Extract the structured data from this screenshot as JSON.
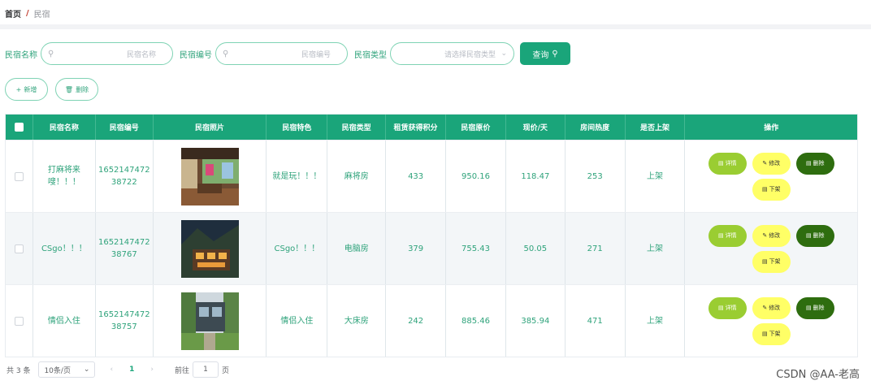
{
  "breadcrumb": {
    "home": "首页",
    "sep": "/",
    "current": "民宿"
  },
  "search": {
    "name_label": "民宿名称",
    "name_placeholder": "民宿名称",
    "code_label": "民宿编号",
    "code_placeholder": "民宿编号",
    "type_label": "民宿类型",
    "type_placeholder": "请选择民宿类型",
    "query_label": "查询"
  },
  "actions": {
    "add_label": "新增",
    "delete_label": "删除"
  },
  "table": {
    "headers": [
      "民宿名称",
      "民宿编号",
      "民宿照片",
      "民宿特色",
      "民宿类型",
      "租赁获得积分",
      "民宿原价",
      "现价/天",
      "房间热度",
      "是否上架",
      "操作"
    ],
    "rows": [
      {
        "name": "打麻将来嗖！！！",
        "code": "1652147472 38722",
        "feature": "就是玩！！！",
        "type": "麻将房",
        "points": "433",
        "orig": "950.16",
        "now": "118.47",
        "heat": "253",
        "pub": "上架"
      },
      {
        "name": "CSgo！！！",
        "code": "1652147472 38767",
        "feature": "CSgo！！！",
        "type": "电脑房",
        "points": "379",
        "orig": "755.43",
        "now": "50.05",
        "heat": "271",
        "pub": "上架"
      },
      {
        "name": "情侣入住",
        "code": "1652147472 38757",
        "feature": "情侣入住",
        "type": "大床房",
        "points": "242",
        "orig": "885.46",
        "now": "385.94",
        "heat": "471",
        "pub": "上架"
      }
    ],
    "ops": {
      "detail": "详情",
      "edit": "修改",
      "delete": "删除",
      "down": "下架"
    }
  },
  "pager": {
    "total": "共 3 条",
    "size": "10条/页",
    "page": "1",
    "goto": "前往",
    "jump_value": "1",
    "page_unit": "页"
  },
  "watermark": "CSDN @AA-老高",
  "colors": {
    "primary": "#1aa57a",
    "detail": "#9acd32",
    "edit": "#ffff66",
    "delete": "#2e6d0f"
  }
}
